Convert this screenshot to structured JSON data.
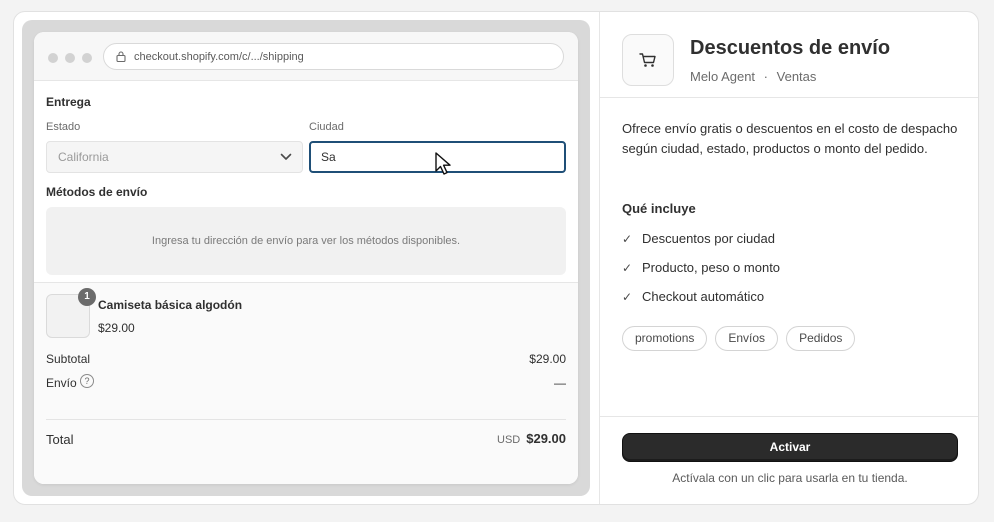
{
  "checkout": {
    "url": "checkout.shopify.com/c/.../shipping",
    "delivery_title": "Entrega",
    "state_label": "Estado",
    "state_value": "California",
    "city_label": "Ciudad",
    "city_value": "Sa",
    "shipping_methods_title": "Métodos de envío",
    "shipping_placeholder": "Ingresa tu dirección de envío para ver los métodos disponibles.",
    "product": {
      "quantity": "1",
      "name": "Camiseta básica algodón",
      "price": "$29.00"
    },
    "subtotal_label": "Subtotal",
    "subtotal_value": "$29.00",
    "shipping_label": "Envío",
    "shipping_value": "—",
    "help_glyph": "?",
    "total_label": "Total",
    "total_currency": "USD",
    "total_value": "$29.00"
  },
  "app": {
    "icon": "cart-icon",
    "title": "Descuentos de envío",
    "developer": "Melo Agent",
    "separator": "·",
    "category": "Ventas",
    "description": "Ofrece envío gratis o descuentos en el costo de despacho según ciudad, estado, productos o monto del pedido.",
    "includes_title": "Qué incluye",
    "check_glyph": "✓",
    "features": [
      "Descuentos por ciudad",
      "Producto, peso o monto",
      "Checkout automático"
    ],
    "tags": [
      "promotions",
      "Envíos",
      "Pedidos"
    ],
    "activate_label": "Activar",
    "activate_note": "Actívala con un clic para usarla en tu tienda."
  },
  "colors": {
    "accent_border": "#1f4f77",
    "primary_button": "#2b2b2b"
  }
}
